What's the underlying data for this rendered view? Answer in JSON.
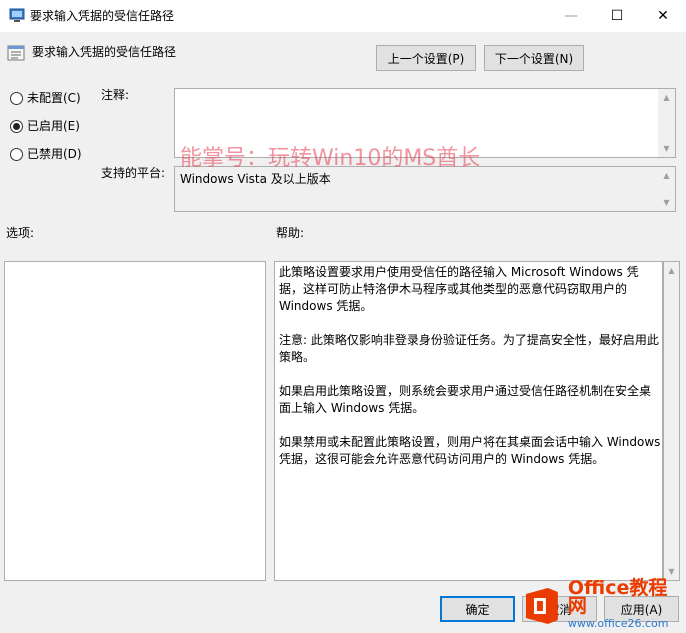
{
  "window": {
    "title": "要求输入凭据的受信任路径",
    "controls": {
      "minimize": "—",
      "maximize": "☐",
      "close": "✕"
    }
  },
  "header": {
    "title": "要求输入凭据的受信任路径",
    "prev_setting": "上一个设置(P)",
    "next_setting": "下一个设置(N)"
  },
  "state": {
    "options": [
      {
        "label": "未配置(C)",
        "checked": false
      },
      {
        "label": "已启用(E)",
        "checked": true
      },
      {
        "label": "已禁用(D)",
        "checked": false
      }
    ]
  },
  "comment": {
    "label": "注释:",
    "value": ""
  },
  "platform": {
    "label": "支持的平台:",
    "value": "Windows Vista 及以上版本"
  },
  "options_section": {
    "label": "选项:"
  },
  "help_section": {
    "label": "帮助:",
    "paragraphs": [
      "此策略设置要求用户使用受信任的路径输入 Microsoft Windows 凭据，这样可防止特洛伊木马程序或其他类型的恶意代码窃取用户的 Windows 凭据。",
      "注意: 此策略仅影响非登录身份验证任务。为了提高安全性，最好启用此策略。",
      "如果启用此策略设置，则系统会要求用户通过受信任路径机制在安全桌面上输入 Windows 凭据。",
      "如果禁用或未配置此策略设置，则用户将在其桌面会话中输入 Windows 凭据，这很可能会允许恶意代码访问用户的 Windows 凭据。"
    ]
  },
  "footer": {
    "ok": "确定",
    "cancel": "取消",
    "apply": "应用(A)"
  },
  "watermark": {
    "text": "能掌号：玩转Win10的MS酋长"
  },
  "brand": {
    "name": "Office教程网",
    "url": "www.office26.com"
  }
}
